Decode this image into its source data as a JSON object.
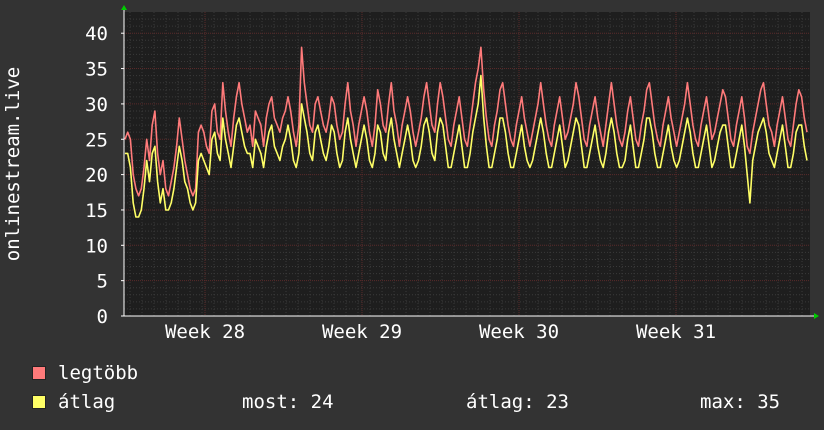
{
  "colors": {
    "background": "#333333",
    "plot_background": "#1e1e1e",
    "grid_minor": "#3a3a3a",
    "grid_major": "#5a2a2a",
    "axis": "#ffffff",
    "arrow": "#00cc00",
    "max_series": "#ff7a7a",
    "avg_series": "#ffff66"
  },
  "chart_data": {
    "type": "line",
    "ylabel": "onlinestream.live",
    "ylim": [
      0,
      43
    ],
    "yticks": [
      0,
      5,
      10,
      15,
      20,
      25,
      30,
      35,
      40
    ],
    "grid": true,
    "x_tick_labels": [
      "Week 28",
      "Week 29",
      "Week 30",
      "Week 31"
    ],
    "series": [
      {
        "name": "legtöbb",
        "color": "#ff7a7a",
        "values": [
          25,
          26,
          25,
          20,
          18,
          17,
          18,
          21,
          25,
          22,
          27,
          29,
          23,
          20,
          22,
          18,
          17,
          19,
          21,
          24,
          28,
          25,
          22,
          20,
          18,
          17,
          18,
          26,
          27,
          26,
          24,
          23,
          29,
          30,
          26,
          25,
          33,
          29,
          26,
          24,
          28,
          31,
          33,
          30,
          28,
          26,
          27,
          24,
          29,
          28,
          27,
          24,
          28,
          30,
          31,
          28,
          27,
          26,
          28,
          29,
          31,
          29,
          26,
          24,
          27,
          38,
          33,
          30,
          27,
          26,
          30,
          31,
          29,
          27,
          26,
          28,
          31,
          30,
          27,
          25,
          26,
          30,
          33,
          29,
          27,
          24,
          27,
          29,
          31,
          29,
          26,
          24,
          27,
          32,
          30,
          27,
          26,
          30,
          33,
          29,
          27,
          24,
          27,
          29,
          31,
          29,
          26,
          24,
          26,
          28,
          31,
          33,
          30,
          27,
          26,
          30,
          33,
          31,
          28,
          25,
          24,
          27,
          29,
          31,
          28,
          25,
          24,
          27,
          30,
          33,
          35,
          38,
          32,
          28,
          25,
          24,
          27,
          29,
          32,
          33,
          30,
          27,
          25,
          24,
          27,
          29,
          31,
          28,
          26,
          24,
          26,
          28,
          30,
          33,
          30,
          27,
          25,
          24,
          27,
          29,
          31,
          28,
          25,
          26,
          28,
          30,
          33,
          31,
          28,
          25,
          24,
          27,
          29,
          31,
          28,
          26,
          24,
          27,
          30,
          33,
          30,
          27,
          25,
          24,
          26,
          29,
          31,
          28,
          25,
          24,
          27,
          29,
          32,
          33,
          30,
          27,
          25,
          24,
          27,
          29,
          31,
          28,
          26,
          24,
          26,
          28,
          30,
          33,
          30,
          27,
          25,
          24,
          27,
          29,
          31,
          28,
          25,
          26,
          28,
          30,
          32,
          31,
          28,
          25,
          24,
          27,
          29,
          31,
          28,
          24,
          23,
          26,
          28,
          30,
          32,
          33,
          30,
          27,
          26,
          24,
          27,
          29,
          31,
          28,
          25,
          24,
          27,
          30,
          32,
          31,
          28,
          26
        ]
      },
      {
        "name": "átlag",
        "color": "#ffff66",
        "values": [
          23,
          23,
          21,
          16,
          14,
          14,
          15,
          18,
          22,
          19,
          23,
          24,
          19,
          16,
          18,
          15,
          15,
          16,
          18,
          21,
          24,
          22,
          19,
          18,
          16,
          15,
          16,
          22,
          23,
          22,
          21,
          20,
          25,
          26,
          23,
          22,
          28,
          25,
          23,
          21,
          24,
          27,
          28,
          26,
          24,
          23,
          23,
          21,
          25,
          24,
          23,
          21,
          24,
          26,
          27,
          24,
          23,
          22,
          24,
          25,
          27,
          25,
          22,
          21,
          23,
          30,
          28,
          26,
          23,
          22,
          26,
          27,
          25,
          23,
          22,
          24,
          27,
          26,
          23,
          21,
          22,
          26,
          28,
          25,
          23,
          21,
          23,
          25,
          27,
          25,
          22,
          21,
          23,
          27,
          26,
          23,
          22,
          26,
          28,
          25,
          23,
          21,
          23,
          25,
          27,
          25,
          22,
          21,
          22,
          24,
          27,
          28,
          26,
          23,
          22,
          26,
          28,
          27,
          24,
          21,
          21,
          23,
          25,
          27,
          24,
          21,
          21,
          23,
          26,
          28,
          30,
          34,
          28,
          24,
          21,
          21,
          23,
          25,
          28,
          28,
          26,
          23,
          21,
          21,
          23,
          25,
          27,
          24,
          22,
          21,
          22,
          24,
          26,
          28,
          26,
          23,
          21,
          21,
          23,
          25,
          27,
          24,
          21,
          22,
          24,
          26,
          28,
          27,
          24,
          21,
          21,
          23,
          25,
          27,
          24,
          22,
          21,
          23,
          26,
          28,
          26,
          23,
          21,
          21,
          22,
          25,
          27,
          24,
          21,
          21,
          23,
          25,
          28,
          28,
          26,
          23,
          21,
          21,
          23,
          25,
          27,
          24,
          22,
          21,
          22,
          24,
          26,
          28,
          26,
          23,
          21,
          21,
          23,
          25,
          27,
          24,
          21,
          22,
          24,
          26,
          27,
          27,
          24,
          21,
          21,
          23,
          25,
          27,
          24,
          20,
          16,
          22,
          24,
          26,
          27,
          28,
          26,
          23,
          22,
          21,
          23,
          25,
          27,
          24,
          21,
          21,
          23,
          26,
          27,
          27,
          24,
          22
        ]
      }
    ]
  },
  "legend": {
    "max_label": "legtöbb",
    "avg_label": "átlag"
  },
  "stats": {
    "now": "most: 24",
    "avg": "átlag: 23",
    "max": "max: 35"
  }
}
